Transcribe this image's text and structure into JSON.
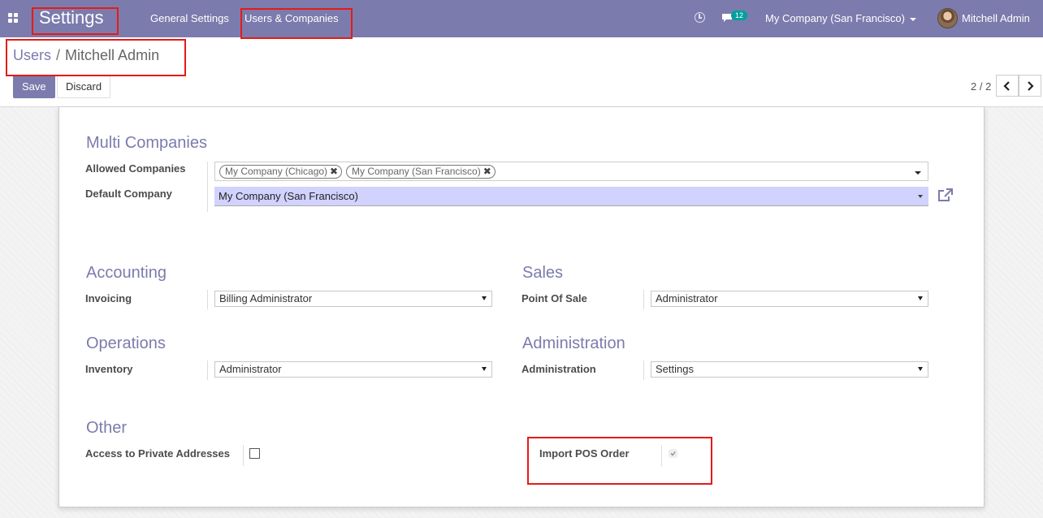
{
  "navbar": {
    "app_title": "Settings",
    "menu": [
      "General Settings",
      "Users & Companies"
    ],
    "activity_icon": "clock-icon",
    "messages_icon": "chat-icon",
    "messages_count": "12",
    "company": "My Company (San Francisco)",
    "user": "Mitchell Admin",
    "bg_color": "#7c7bad"
  },
  "breadcrumb": {
    "parent": "Users",
    "separator": "/",
    "current": "Mitchell Admin"
  },
  "buttons": {
    "save": "Save",
    "discard": "Discard"
  },
  "pager": {
    "value": "2 / 2"
  },
  "multi_companies": {
    "title": "Multi Companies",
    "allowed_label": "Allowed Companies",
    "allowed_tags": [
      "My Company (Chicago)",
      "My Company (San Francisco)"
    ],
    "default_label": "Default Company",
    "default_value": "My Company (San Francisco)"
  },
  "accounting": {
    "title": "Accounting",
    "invoicing_label": "Invoicing",
    "invoicing_value": "Billing Administrator"
  },
  "sales": {
    "title": "Sales",
    "pos_label": "Point Of Sale",
    "pos_value": "Administrator"
  },
  "operations": {
    "title": "Operations",
    "inventory_label": "Inventory",
    "inventory_value": "Administrator"
  },
  "administration": {
    "title": "Administration",
    "admin_label": "Administration",
    "admin_value": "Settings"
  },
  "other": {
    "title": "Other",
    "private_label": "Access to Private Addresses",
    "private_checked": false,
    "import_pos_label": "Import POS Order",
    "import_pos_checked": true
  },
  "colors": {
    "accent": "#7c7bad",
    "highlight": "#e41b17",
    "many2one_bg": "#d2d2ff"
  }
}
